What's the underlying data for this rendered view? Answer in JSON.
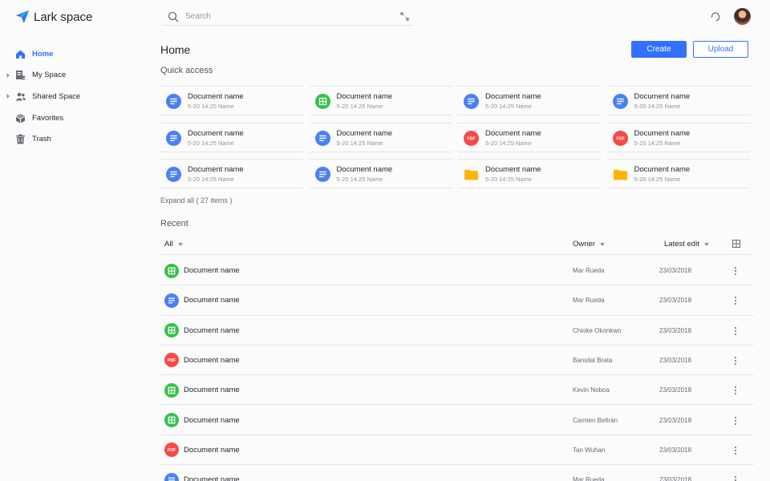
{
  "app": {
    "name": "Lark space"
  },
  "search": {
    "placeholder": "Search"
  },
  "sidebar": {
    "items": [
      {
        "label": "Home",
        "icon": "home-icon",
        "active": true
      },
      {
        "label": "My Space",
        "icon": "my-space-icon",
        "expandable": true
      },
      {
        "label": "Shared Space",
        "icon": "people-icon",
        "expandable": true
      },
      {
        "label": "Favorites",
        "icon": "cube-icon"
      },
      {
        "label": "Trash",
        "icon": "trash-icon"
      }
    ]
  },
  "header": {
    "title": "Home",
    "create_label": "Create",
    "upload_label": "Upload"
  },
  "quick_access": {
    "title": "Quick access",
    "items": [
      {
        "name": "Document name",
        "meta": "5-20 14:25 Name",
        "type": "doc"
      },
      {
        "name": "Document name",
        "meta": "5-20 14:25 Name",
        "type": "sheet"
      },
      {
        "name": "Document name",
        "meta": "5-20 14:25 Name",
        "type": "doc"
      },
      {
        "name": "Document name",
        "meta": "5-20 14:25 Name",
        "type": "doc"
      },
      {
        "name": "Document name",
        "meta": "5-20 14:25 Name",
        "type": "doc"
      },
      {
        "name": "Document name",
        "meta": "5-20 14:25 Name",
        "type": "doc"
      },
      {
        "name": "Document name",
        "meta": "5-20 14:25 Name",
        "type": "pdf"
      },
      {
        "name": "Document name",
        "meta": "5-20 14:25 Name",
        "type": "pdf"
      },
      {
        "name": "Document name",
        "meta": "5-20 14:25 Name",
        "type": "doc"
      },
      {
        "name": "Document name",
        "meta": "5-20 14:25 Name",
        "type": "doc"
      },
      {
        "name": "Document name",
        "meta": "5-20 14:25 Name",
        "type": "folder"
      },
      {
        "name": "Document name",
        "meta": "5-20 14:25 Name",
        "type": "folder"
      }
    ],
    "expand_label": "Expand all ( 27 items )"
  },
  "recent": {
    "title": "Recent",
    "columns": {
      "filter": "All",
      "owner": "Owner",
      "latest_edit": "Latest edit"
    },
    "rows": [
      {
        "name": "Document name",
        "owner": "Mar Rueda",
        "date": "23/03/2018",
        "type": "sheet"
      },
      {
        "name": "Document name",
        "owner": "Mar Rueda",
        "date": "23/03/2018",
        "type": "doc"
      },
      {
        "name": "Document name",
        "owner": "Chioke Okonkwo",
        "date": "23/03/2018",
        "type": "sheet"
      },
      {
        "name": "Document name",
        "owner": "Bansilal Brata",
        "date": "23/03/2018",
        "type": "pdf"
      },
      {
        "name": "Document name",
        "owner": "Kevin Noboa",
        "date": "23/03/2018",
        "type": "sheet"
      },
      {
        "name": "Document name",
        "owner": "Carmen Beltrán",
        "date": "23/03/2018",
        "type": "sheet"
      },
      {
        "name": "Document name",
        "owner": "Tan Wuhan",
        "date": "23/03/2018",
        "type": "pdf"
      },
      {
        "name": "Document name",
        "owner": "Mar Rueda",
        "date": "23/03/2018",
        "type": "doc"
      }
    ]
  },
  "colors": {
    "accent": "#3370ff",
    "doc": "#4a80f5",
    "sheet": "#34c24a",
    "pdf": "#f54a45",
    "folder": "#ffb300"
  }
}
